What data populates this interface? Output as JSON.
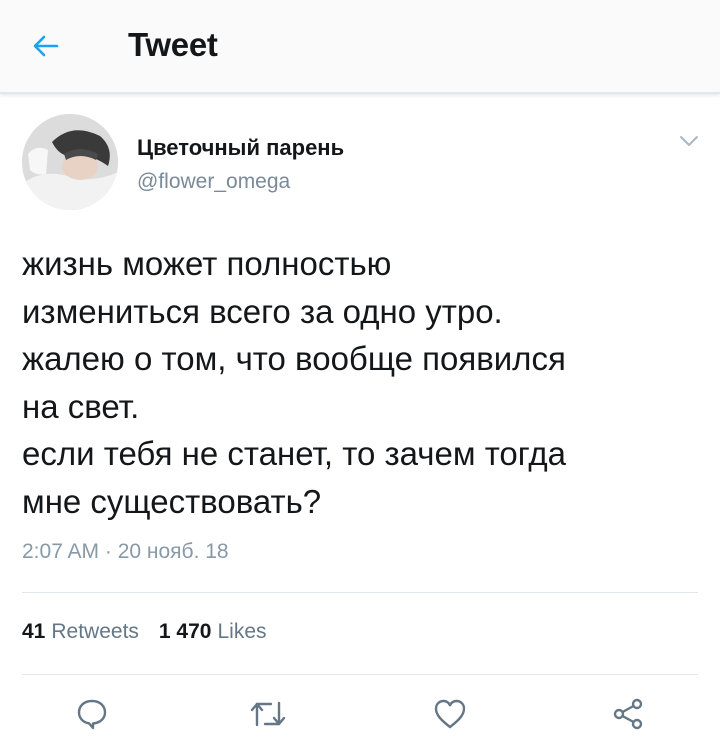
{
  "header": {
    "title": "Tweet",
    "back_icon": "arrow-left-icon",
    "accent_color": "#1da1f2"
  },
  "author": {
    "display_name": "Цветочный парень",
    "handle": "@flower_omega"
  },
  "tweet": {
    "text": "жизнь может полностью\nизмениться всего за одно утро.\nжалею о том, что вообще появился\nна свет.\nесли тебя не станет, то зачем тогда\nмне существовать?",
    "timestamp": "2:07 AM · 20 нояб. 18"
  },
  "stats": {
    "retweets_count": "41",
    "retweets_label": "Retweets",
    "likes_count": "1 470",
    "likes_label": "Likes"
  },
  "actions": {
    "icons": [
      "reply-icon",
      "retweet-icon",
      "like-icon",
      "share-icon"
    ],
    "icon_color": "#657786"
  }
}
